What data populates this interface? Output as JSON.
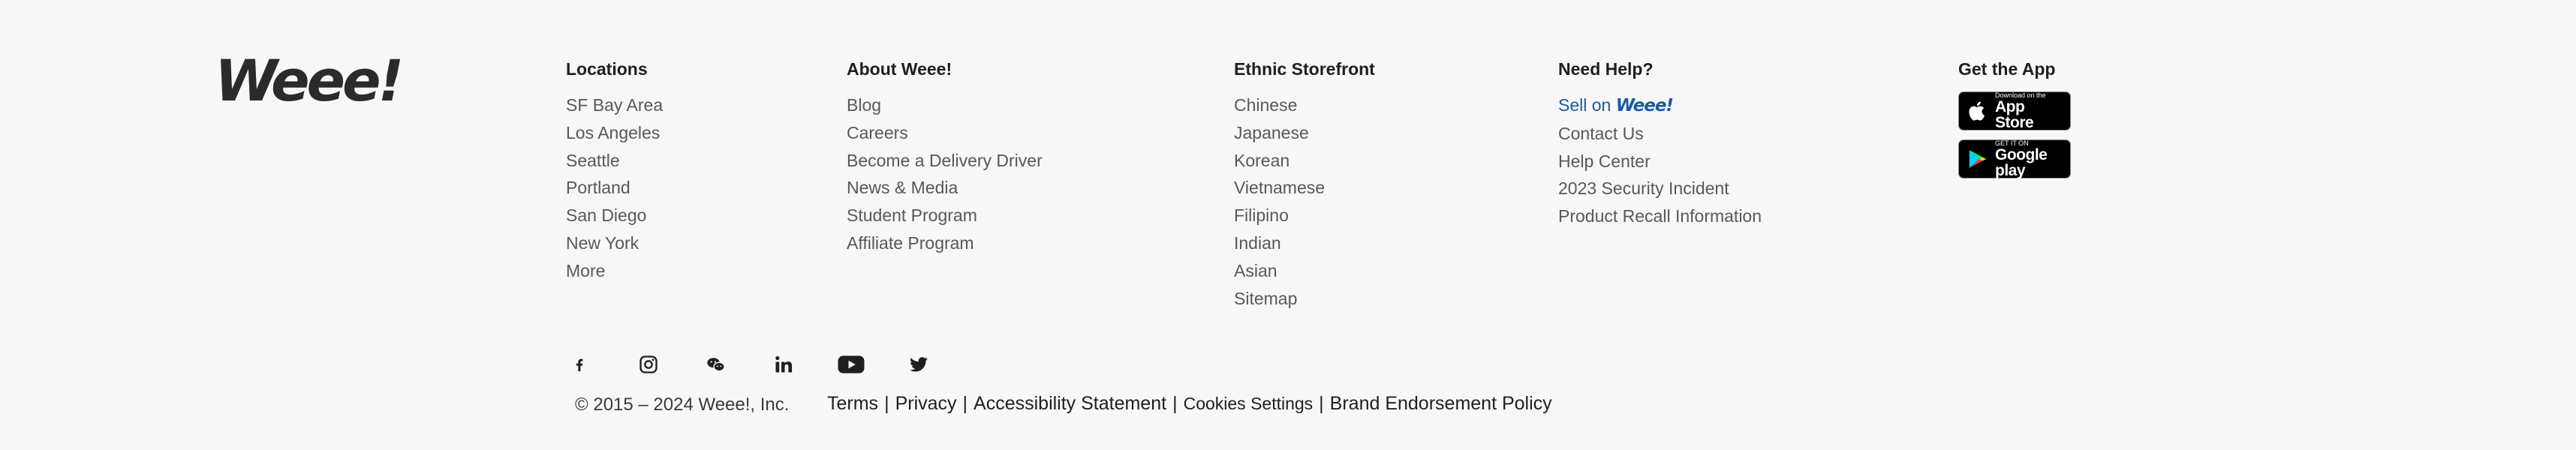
{
  "logo": "Weee!",
  "columns": {
    "locations": {
      "title": "Locations",
      "items": [
        "SF Bay Area",
        "Los Angeles",
        "Seattle",
        "Portland",
        "San Diego",
        "New York",
        "More"
      ]
    },
    "about": {
      "title": "About Weee!",
      "items": [
        "Blog",
        "Careers",
        "Become a Delivery Driver",
        "News & Media",
        "Student Program",
        "Affiliate Program"
      ]
    },
    "ethnic": {
      "title": "Ethnic Storefront",
      "items": [
        "Chinese",
        "Japanese",
        "Korean",
        "Vietnamese",
        "Filipino",
        "Indian",
        "Asian",
        "Sitemap"
      ]
    },
    "help": {
      "title": "Need Help?",
      "sell_prefix": "Sell on",
      "sell_brand": "Weee!",
      "items": [
        "Contact Us",
        "Help Center",
        "2023 Security Incident",
        "Product Recall Information"
      ]
    },
    "app": {
      "title": "Get the App",
      "appstore_small": "Download on the",
      "appstore_big": "App Store",
      "googleplay_small": "GET IT ON",
      "googleplay_big": "Google play"
    }
  },
  "social_icons": [
    "facebook-icon",
    "instagram-icon",
    "wechat-icon",
    "linkedin-icon",
    "youtube-icon",
    "twitter-icon"
  ],
  "copyright": "© 2015 – 2024 Weee!, Inc.",
  "legal": {
    "terms": "Terms",
    "privacy": "Privacy",
    "accessibility": "Accessibility Statement",
    "cookies": "Cookies Settings",
    "brand": "Brand Endorsement Policy",
    "separator": "|"
  }
}
